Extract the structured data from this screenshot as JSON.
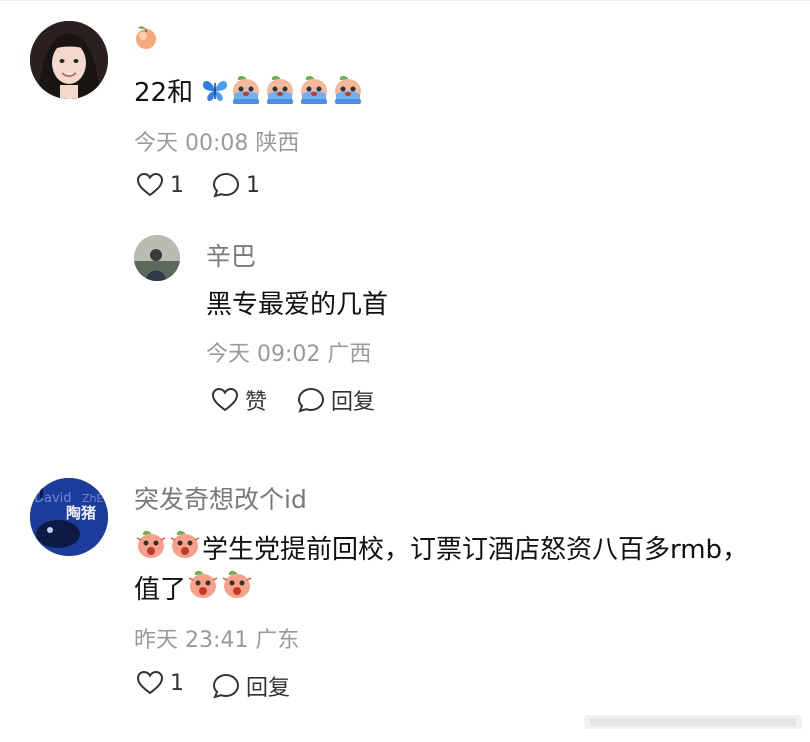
{
  "comments": [
    {
      "badge_icon": "peach-icon",
      "text_prefix": "22和",
      "time": "今天 00:08",
      "location": "陕西",
      "likes": "1",
      "replies": "1"
    },
    {
      "author": "辛巴",
      "text": "黑专最爱的几首",
      "time": "今天 09:02",
      "location": "广西",
      "like_label": "赞",
      "reply_label": "回复"
    },
    {
      "author": "突发奇想改个id",
      "avatar_text_1": "David",
      "avatar_text_2": "ZhE",
      "avatar_text_3": "陶猪",
      "text_line1": "学生党提前回校，订票订酒店怒资八百多rmb，",
      "text_line2_prefix": "值了",
      "time": "昨天 23:41",
      "location": "广东",
      "likes": "1",
      "reply_label": "回复"
    }
  ],
  "icons": {
    "like": "heart-outline-icon",
    "reply": "speech-bubble-icon",
    "butterfly": "blue-butterfly-emoji",
    "crying": "crying-peach-emoji",
    "shocked": "shocked-peach-emoji"
  },
  "colors": {
    "secondary_text": "#9a9a9a",
    "name_text": "#7a7a7a",
    "primary_text": "#111111"
  }
}
